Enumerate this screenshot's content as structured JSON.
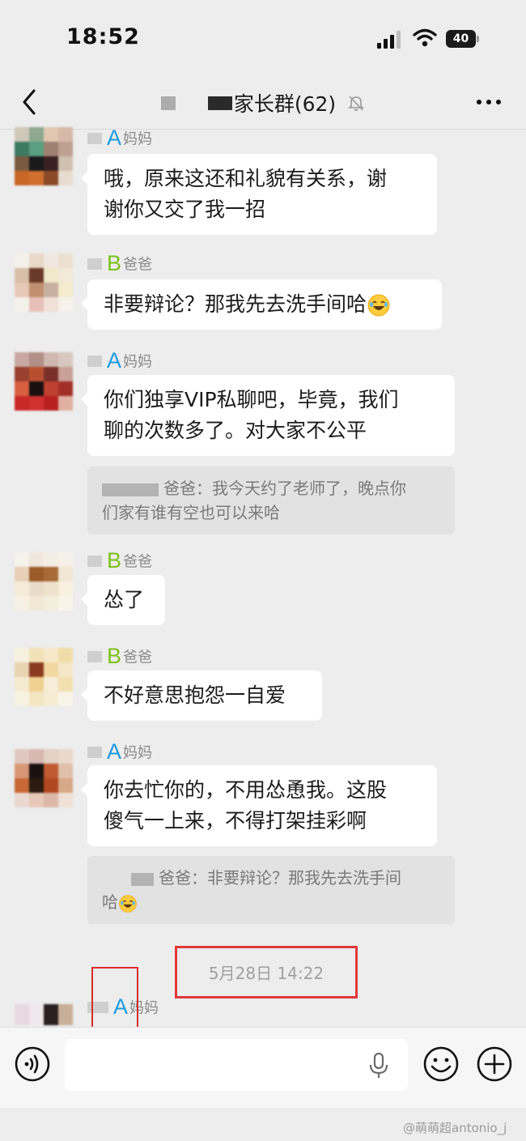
{
  "status_bar": {
    "time": "18:52",
    "battery": "40"
  },
  "nav": {
    "title": "家长群(62)"
  },
  "messages": [
    {
      "tag": "A",
      "role": "妈妈",
      "text_lines": [
        "哦，原来这还和礼貌有关系，谢",
        "谢你又交了我一招"
      ]
    },
    {
      "tag": "B",
      "role": "爸爸",
      "text": "非要辩论？那我先去洗手间哈"
    },
    {
      "tag": "A",
      "role": "妈妈",
      "text_lines": [
        "你们独享VIP私聊吧，毕竟，我们",
        "聊的次数多了。对大家不公平"
      ],
      "quote_lines": [
        "爸爸：我今天约了老师了，晚点你",
        "们家有谁有空也可以来哈"
      ]
    },
    {
      "tag": "B",
      "role": "爸爸",
      "text": "怂了"
    },
    {
      "tag": "B",
      "role": "爸爸",
      "text": "不好意思抱怨一自爱"
    },
    {
      "tag": "A",
      "role": "妈妈",
      "text_lines": [
        "你去忙你的，不用怂恿我。这股",
        "傻气一上来，不得打架挂彩啊"
      ],
      "quote_lines": [
        "爸爸：非要辩论？那我先去洗手间",
        "哈"
      ]
    },
    {
      "tag": "A",
      "role": "妈妈"
    }
  ],
  "timestamp": "5月28日 14:22",
  "watermark": "@萌萌超antonio_j",
  "icons": [
    "back-icon",
    "mute-icon",
    "more-icon",
    "voice-icon",
    "mic-icon",
    "emoji-icon",
    "add-icon",
    "laughing-emoji"
  ],
  "colors": {
    "background": "#ededed",
    "bubble": "#ffffff",
    "tag_a": "#1e9be0",
    "tag_b": "#7bc11a",
    "highlight": "#e03a3a"
  }
}
